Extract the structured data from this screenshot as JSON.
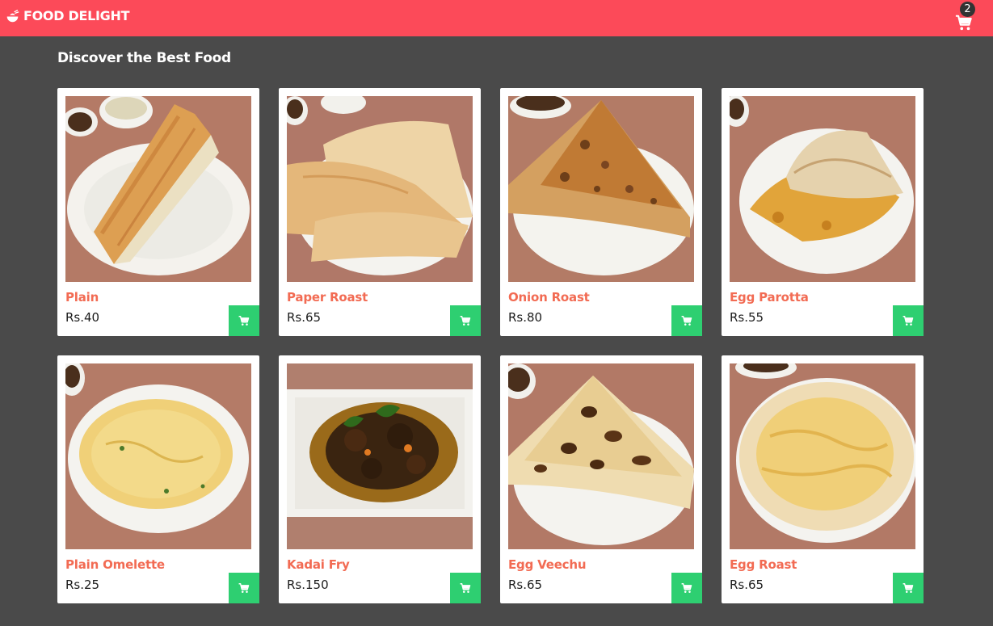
{
  "header": {
    "brand_name": "FOOD DELIGHT",
    "brand_icon": "food-bowl-icon",
    "cart_icon": "cart-icon",
    "cart_count": "2",
    "color": "#fc4a59"
  },
  "main": {
    "title": "Discover the Best Food",
    "add_button_icon": "cart-icon",
    "add_button_color": "#2ecf71",
    "background": "#4a4a4a",
    "items": [
      {
        "name": "Plain",
        "price": "Rs.40",
        "image": "plain-dosa"
      },
      {
        "name": "Paper Roast",
        "price": "Rs.65",
        "image": "paper-roast"
      },
      {
        "name": "Onion Roast",
        "price": "Rs.80",
        "image": "onion-roast"
      },
      {
        "name": "Egg Parotta",
        "price": "Rs.55",
        "image": "egg-parotta"
      },
      {
        "name": "Plain Omelette",
        "price": "Rs.25",
        "image": "plain-omelette"
      },
      {
        "name": "Kadai Fry",
        "price": "Rs.150",
        "image": "kadai-fry"
      },
      {
        "name": "Egg Veechu",
        "price": "Rs.65",
        "image": "egg-veechu"
      },
      {
        "name": "Egg Roast",
        "price": "Rs.65",
        "image": "egg-roast"
      }
    ]
  }
}
